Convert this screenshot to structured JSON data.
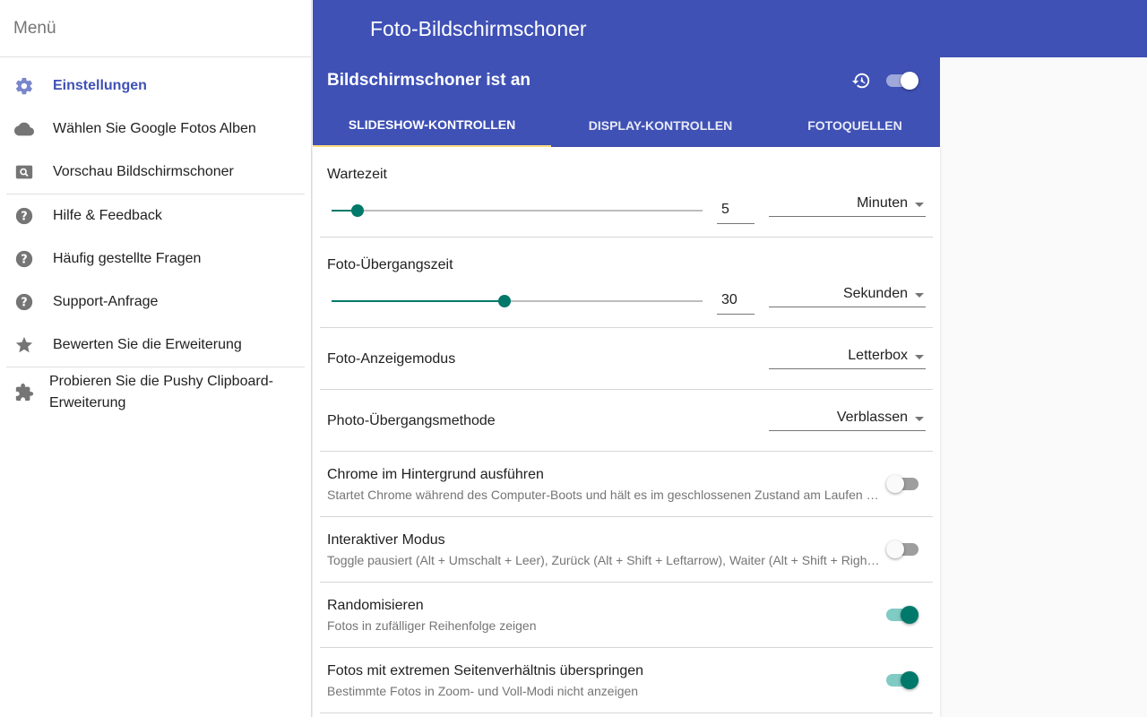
{
  "sidebar": {
    "title": "Menü",
    "items": [
      {
        "label": "Einstellungen",
        "icon": "gear-icon"
      },
      {
        "label": "Wählen Sie Google Fotos Alben",
        "icon": "cloud-icon"
      },
      {
        "label": "Vorschau Bildschirmschoner",
        "icon": "preview-search-icon"
      },
      {
        "label": "Hilfe & Feedback",
        "icon": "help-icon"
      },
      {
        "label": "Häufig gestellte Fragen",
        "icon": "help-icon"
      },
      {
        "label": "Support-Anfrage",
        "icon": "help-icon"
      },
      {
        "label": "Bewerten Sie die Erweiterung",
        "icon": "star-icon"
      },
      {
        "label": "Probieren Sie die Pushy Clipboard-Erweiterung",
        "icon": "puzzle-icon"
      }
    ]
  },
  "topbar": {
    "title": "Foto-Bildschirmschoner"
  },
  "card": {
    "status": "Bildschirmschoner ist an",
    "enabled": true,
    "tabs": [
      "SLIDESHOW-KONTROLLEN",
      "DISPLAY-KONTROLLEN",
      "FOTOQUELLEN"
    ]
  },
  "settings": {
    "wait": {
      "label": "Wartezeit",
      "value": "5",
      "unit": "Minuten",
      "slider_fraction": 0.07
    },
    "transition_time": {
      "label": "Foto-Übergangszeit",
      "value": "30",
      "unit": "Sekunden",
      "slider_fraction": 0.465
    },
    "display_mode": {
      "label": "Foto-Anzeigemodus",
      "value": "Letterbox"
    },
    "transition_method": {
      "label": "Photo-Übergangsmethode",
      "value": "Verblassen"
    },
    "toggles": [
      {
        "label": "Chrome im Hintergrund ausführen",
        "desc": "Startet Chrome während des Computer-Boots und hält es im geschlossenen Zustand am Laufen (e...",
        "on": false
      },
      {
        "label": "Interaktiver Modus",
        "desc": "Toggle pausiert (Alt + Umschalt + Leer), Zurück (Alt + Shift + Leftarrow), Waiter (Alt + Shift + Rightarrow)",
        "on": false
      },
      {
        "label": "Randomisieren",
        "desc": "Fotos in zufälliger Reihenfolge zeigen",
        "on": true
      },
      {
        "label": "Fotos mit extremen Seitenverhältnis überspringen",
        "desc": "Bestimmte Fotos in Zoom- und Voll-Modi nicht anzeigen",
        "on": true
      }
    ]
  },
  "colors": {
    "primary": "#3f51b5",
    "accent": "#00796b",
    "tab_indicator": "#ffe082"
  }
}
